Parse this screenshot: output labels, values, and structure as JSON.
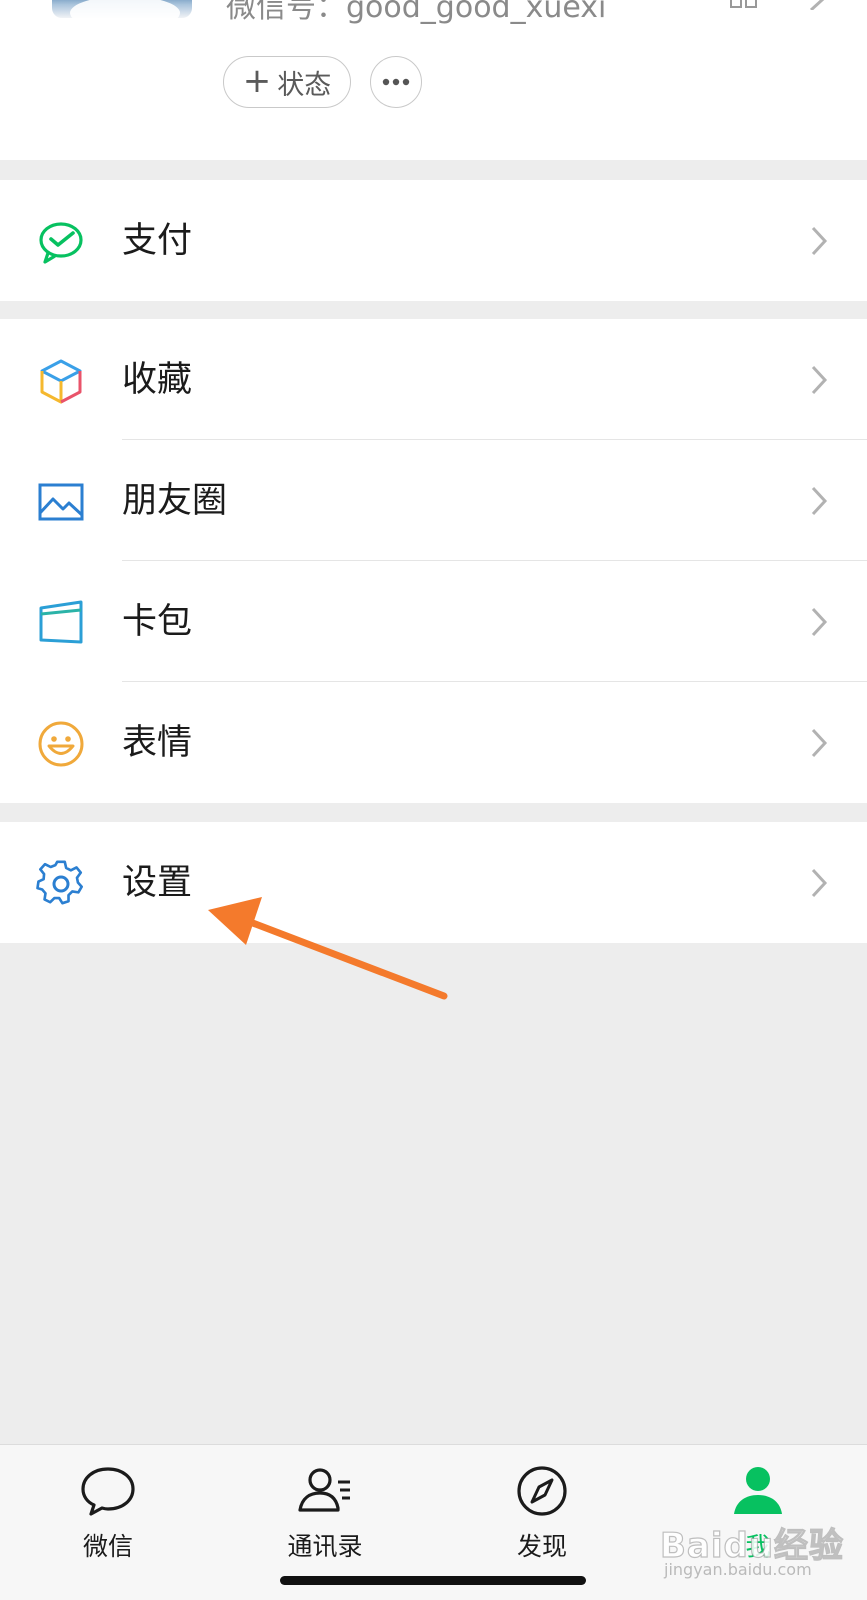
{
  "profile": {
    "wechat_id": "微信号：good_good_xuexi",
    "status_button": {
      "plus": "+",
      "label": "状态"
    }
  },
  "menu": {
    "pay": {
      "label": "支付",
      "icon": "wechat-pay-icon"
    },
    "favorites": {
      "label": "收藏",
      "icon": "favorites-cube-icon"
    },
    "moments": {
      "label": "朋友圈",
      "icon": "moments-photo-icon"
    },
    "cards": {
      "label": "卡包",
      "icon": "card-wallet-icon"
    },
    "stickers": {
      "label": "表情",
      "icon": "smiley-icon"
    },
    "settings": {
      "label": "设置",
      "icon": "gear-icon"
    }
  },
  "tabbar": {
    "tabs": [
      {
        "label": "微信",
        "icon": "chat-bubble-icon",
        "active": false
      },
      {
        "label": "通讯录",
        "icon": "contacts-icon",
        "active": false
      },
      {
        "label": "发现",
        "icon": "compass-icon",
        "active": false
      },
      {
        "label": "我",
        "icon": "person-icon",
        "active": true
      }
    ]
  },
  "watermark": {
    "main": "Baidu经验",
    "sub": "jingyan.baidu.com"
  },
  "colors": {
    "brand_green": "#07c160",
    "annotation_arrow": "#f47a2c",
    "background": "#ededed",
    "settings_icon": "#2b7fd1"
  }
}
